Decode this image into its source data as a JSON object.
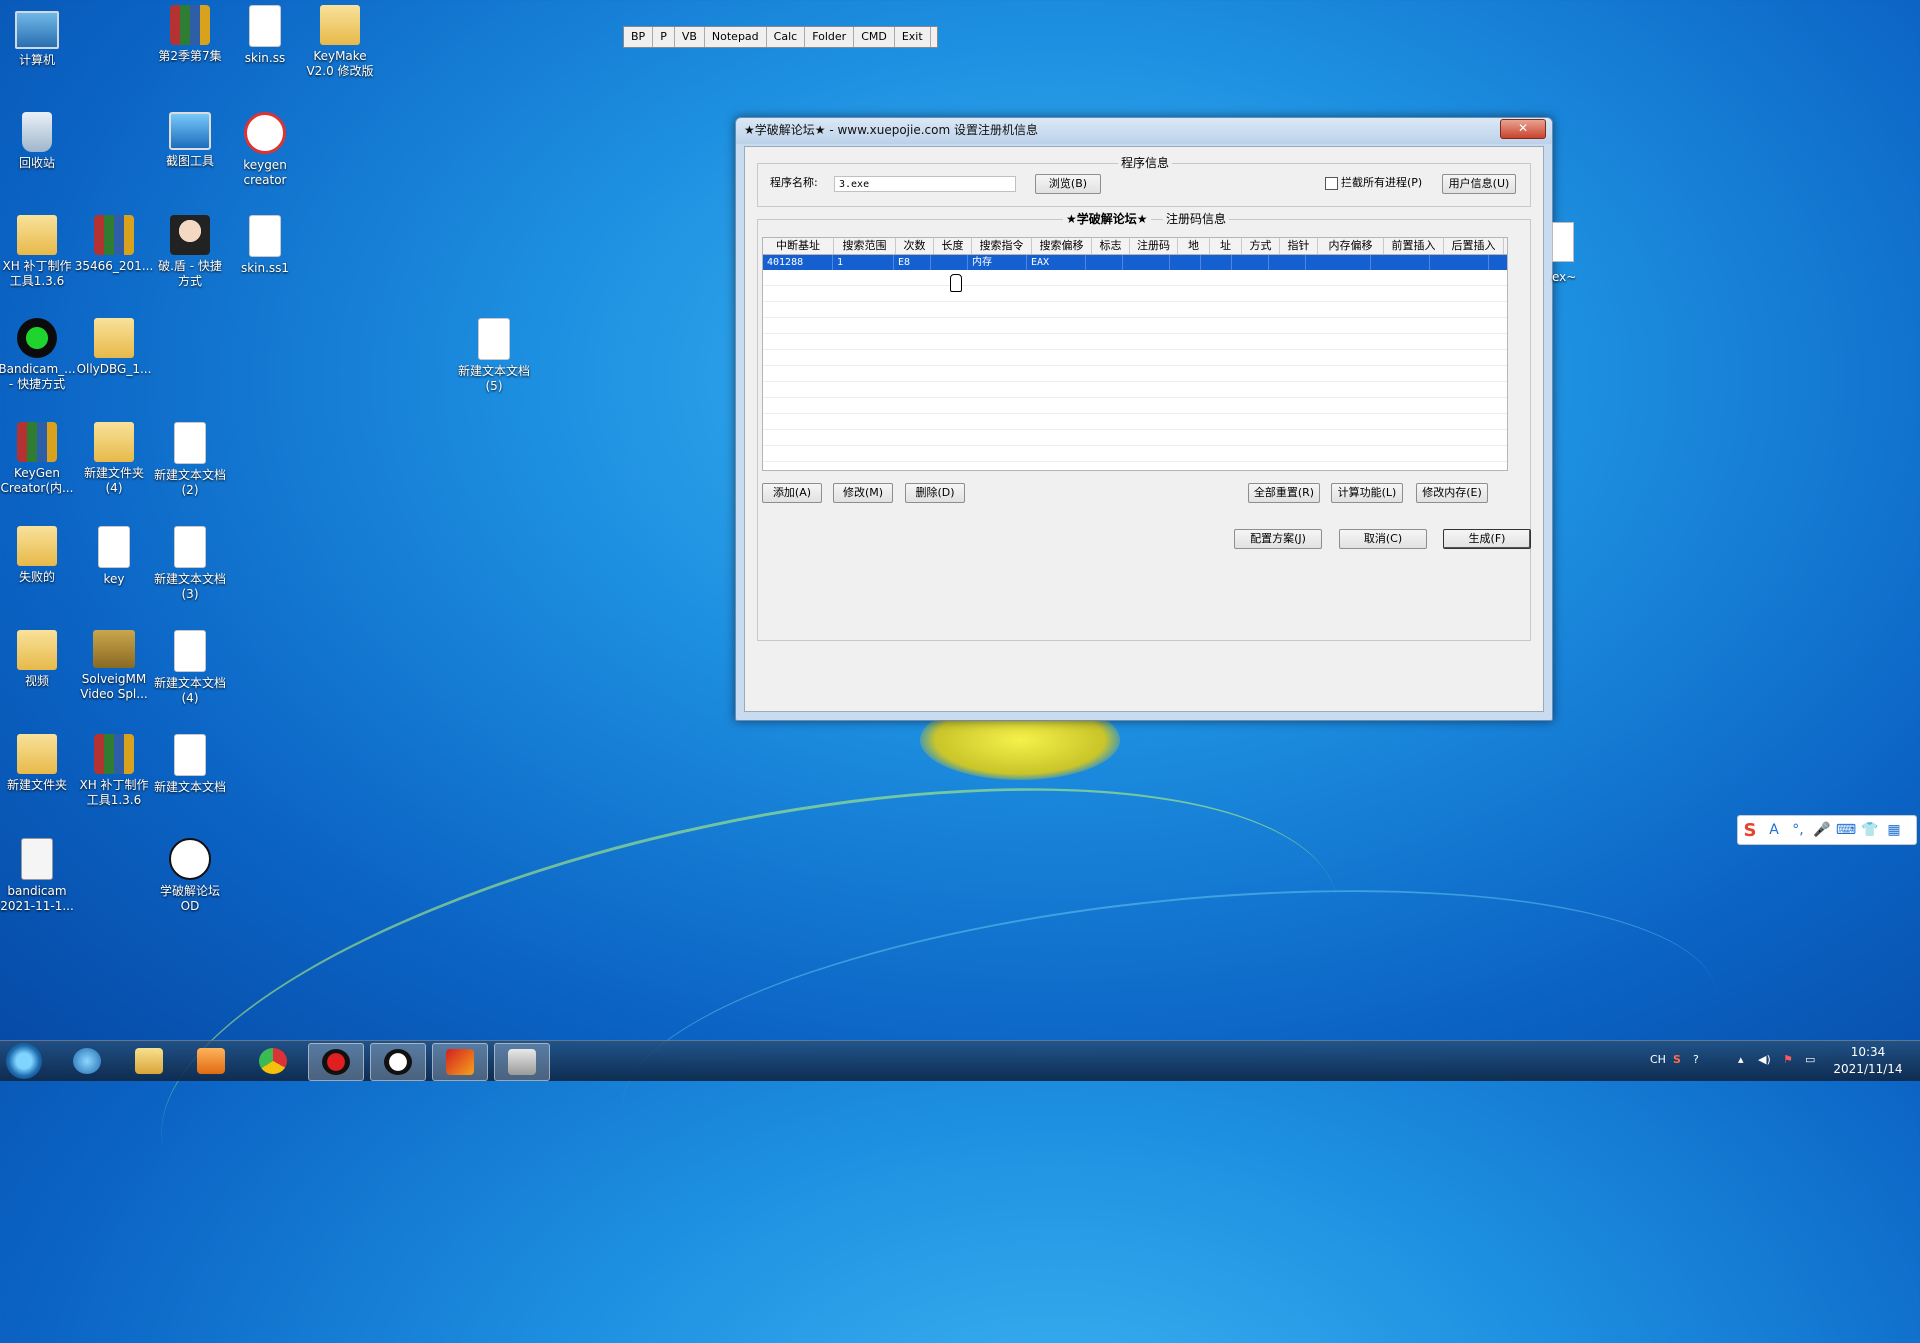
{
  "desktop_icons": [
    {
      "label": "计算机",
      "icon": "computer-icon"
    },
    {
      "label": "第2季第7集",
      "icon": "winrar-archive-icon"
    },
    {
      "label": "skin.ss",
      "icon": "document-icon"
    },
    {
      "label": "KeyMake\nV2.0 修改版",
      "icon": "folder-icon"
    },
    {
      "label": "回收站",
      "icon": "recycle-bin-icon"
    },
    {
      "label": "截图工具",
      "icon": "snipping-tool-icon"
    },
    {
      "label": "keygen\ncreator",
      "icon": "keygen-icon"
    },
    {
      "label": "XH 补丁制作\n工具1.3.6",
      "icon": "folder-icon"
    },
    {
      "label": "35466_201...",
      "icon": "winrar-archive-icon"
    },
    {
      "label": "破.盾 - 快捷\n方式",
      "icon": "anime-shortcut-icon"
    },
    {
      "label": "skin.ss1",
      "icon": "document-icon"
    },
    {
      "label": "Bandicam_...\n- 快捷方式",
      "icon": "bandicam-icon"
    },
    {
      "label": "OllyDBG_1...",
      "icon": "folder-icon"
    },
    {
      "label": "新建文本文档\n(5)",
      "icon": "document-icon"
    },
    {
      "label": "KeyGen\nCreator(内...",
      "icon": "winrar-archive-icon"
    },
    {
      "label": "新建文件夹\n(4)",
      "icon": "folder-icon"
    },
    {
      "label": "新建文本文档\n(2)",
      "icon": "document-icon"
    },
    {
      "label": "失败的",
      "icon": "folder-icon"
    },
    {
      "label": "key",
      "icon": "document-icon"
    },
    {
      "label": "新建文本文档\n(3)",
      "icon": "document-icon"
    },
    {
      "label": "视频",
      "icon": "folder-icon"
    },
    {
      "label": "SolveigMM\nVideo Spl...",
      "icon": "video-splitter-icon"
    },
    {
      "label": "新建文本文档\n(4)",
      "icon": "document-icon"
    },
    {
      "label": "新建文件夹",
      "icon": "folder-icon"
    },
    {
      "label": "XH 补丁制作\n工具1.3.6",
      "icon": "winrar-archive-icon"
    },
    {
      "label": "新建文本文档",
      "icon": "document-icon"
    },
    {
      "label": "bandicam\n2021-11-1...",
      "icon": "avi-file-icon"
    },
    {
      "label": "学破解论坛\nOD",
      "icon": "od-shortcut-icon"
    }
  ],
  "quick_toolbar": [
    "BP",
    "P",
    "VB",
    "Notepad",
    "Calc",
    "Folder",
    "CMD",
    "Exit"
  ],
  "dialog": {
    "title": "★学破解论坛★ - www.xuepojie.com   设置注册机信息",
    "close_label": "✕",
    "program_group": "程序信息",
    "program_name_label": "程序名称:",
    "program_name_value": "3.exe",
    "browse_btn": "浏览(B)",
    "intercept_label": "拦截所有进程(P)",
    "user_info_btn": "用户信息(U)",
    "reg_group_prefix": "★学破解论坛★",
    "reg_group": "注册码信息",
    "columns": [
      "中断基址",
      "搜索范围",
      "次数",
      "长度",
      "搜索指令",
      "搜索偏移",
      "标志",
      "注册码",
      "地",
      "址",
      "方式",
      "指针",
      "内存偏移",
      "前置插入",
      "后置插入"
    ],
    "rows": [
      [
        "401288",
        "1",
        "E8",
        "",
        "内存",
        "EAX",
        "",
        "",
        "",
        "",
        "",
        "",
        "",
        "",
        ""
      ]
    ],
    "add_btn": "添加(A)",
    "modify_btn": "修改(M)",
    "delete_btn": "删除(D)",
    "reset_all_btn": "全部重置(R)",
    "calc_func_btn": "计算功能(L)",
    "modify_mem_btn": "修改内存(E)",
    "config_btn": "配置方案(J)",
    "cancel_btn": "取消(C)",
    "generate_btn": "生成(F)"
  },
  "side_partial_label": "ex~",
  "ime_toolbar": {
    "items": [
      "S",
      "A",
      "°,",
      "🎤",
      "⌨",
      "👕",
      "▦"
    ]
  },
  "taskbar": {
    "items": [
      "start-orb",
      "ie-icon",
      "explorer-icon",
      "media-player-icon",
      "chrome-icon",
      "bandicam-record-icon",
      "od-icon",
      "keygen-red-icon",
      "xuepojie-shark-icon"
    ],
    "tray_lang": "CH",
    "time": "10:34",
    "date": "2021/11/14"
  },
  "colors": {
    "selection": "#1560d1",
    "desktop": "#1d8fe0"
  }
}
